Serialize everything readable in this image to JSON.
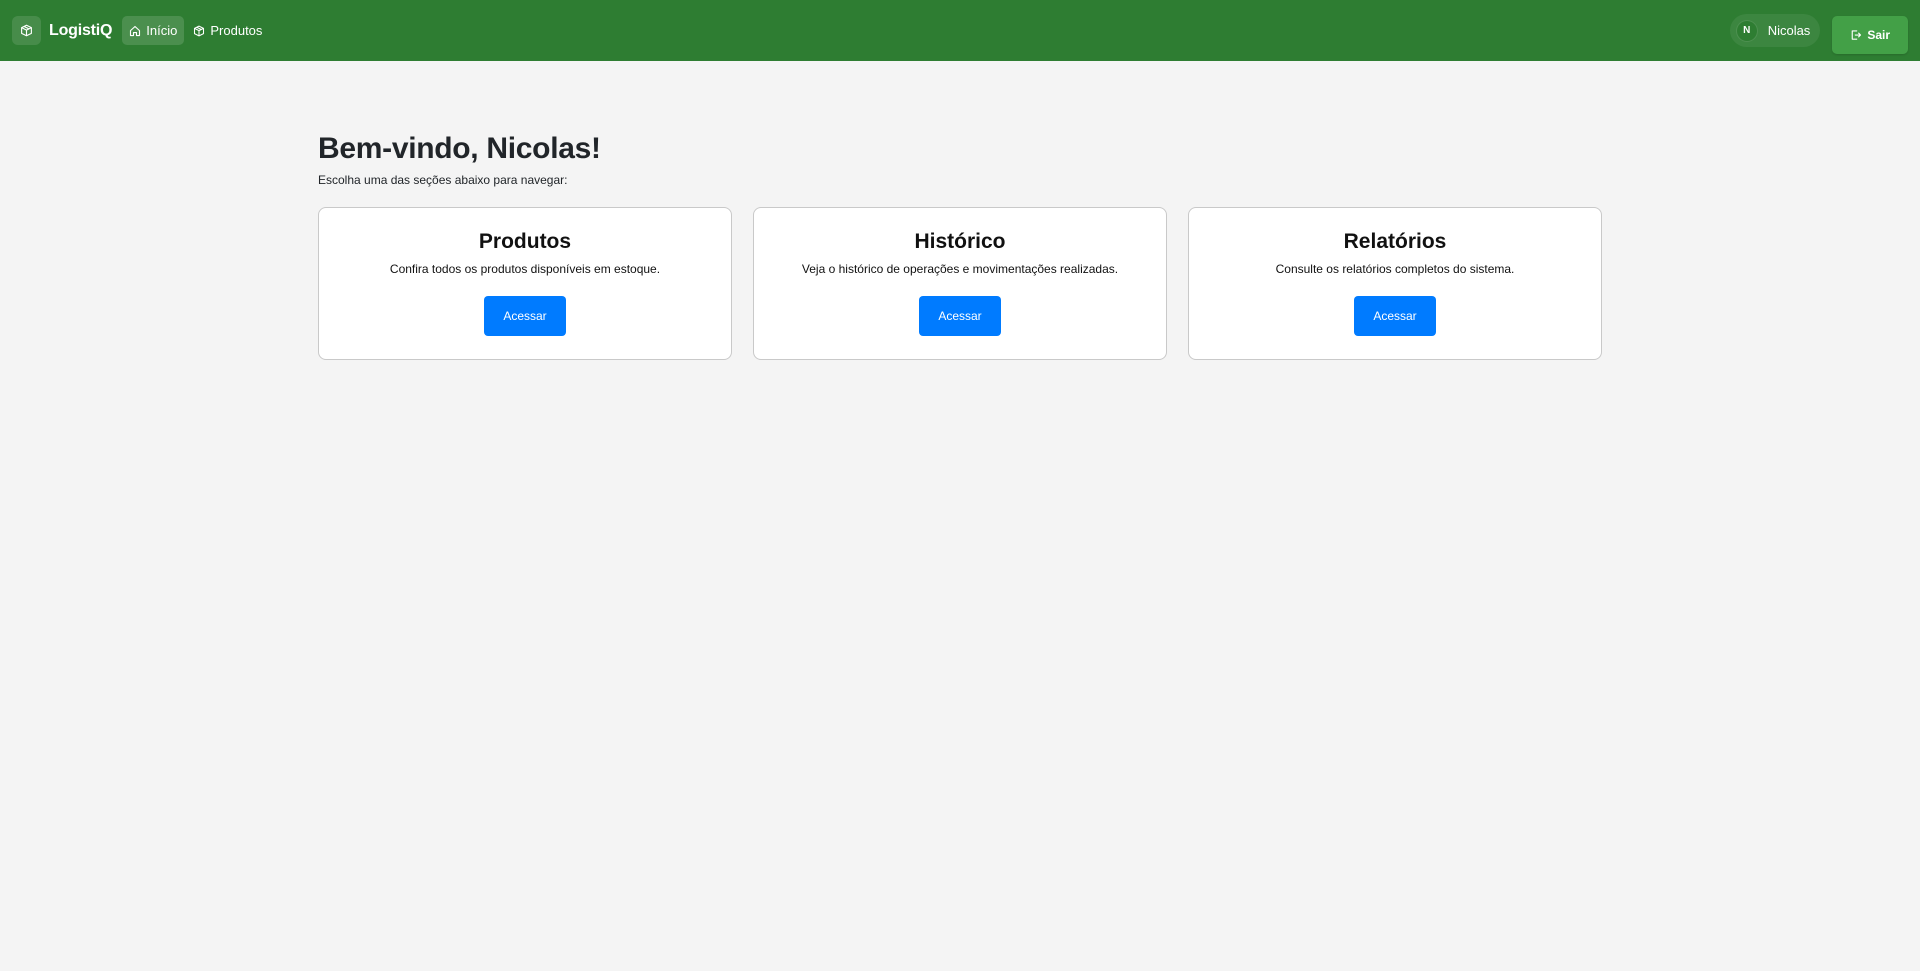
{
  "brand": {
    "name": "LogistiQ",
    "icon": "box-icon"
  },
  "nav": {
    "items": [
      {
        "label": "Início",
        "icon": "home-icon",
        "active": true
      },
      {
        "label": "Produtos",
        "icon": "box-icon",
        "active": false
      }
    ]
  },
  "user": {
    "initial": "N",
    "name": "Nicolas"
  },
  "logout": {
    "label": "Sair",
    "icon": "logout-icon"
  },
  "main": {
    "title": "Bem-vindo, Nicolas!",
    "subtitle": "Escolha uma das seções abaixo para navegar:",
    "cards": [
      {
        "title": "Produtos",
        "text": "Confira todos os produtos disponíveis em estoque.",
        "button": "Acessar"
      },
      {
        "title": "Histórico",
        "text": "Veja o histórico de operações e movimentações realizadas.",
        "button": "Acessar"
      },
      {
        "title": "Relatórios",
        "text": "Consulte os relatórios completos do sistema.",
        "button": "Acessar"
      }
    ]
  },
  "colors": {
    "navbar": "#2e7d32",
    "logout_button": "#43a047",
    "primary_button": "#007bff",
    "background": "#f4f4f4"
  }
}
